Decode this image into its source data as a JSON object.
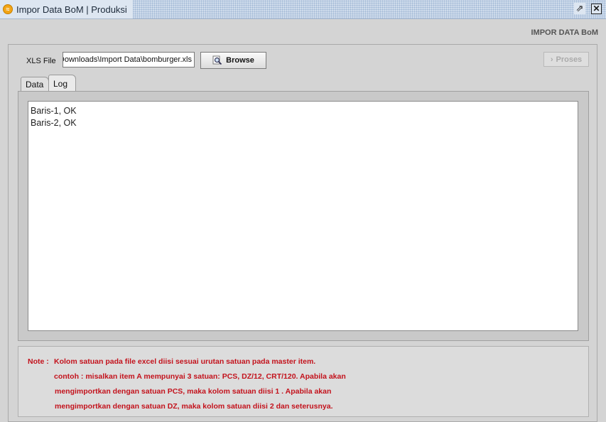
{
  "window": {
    "title": "Impor Data BoM | Produksi",
    "restore_icon": "restore-icon",
    "close_icon": "close-icon"
  },
  "header": {
    "label": "IMPOR DATA BoM"
  },
  "file": {
    "label": "XLS File",
    "value": "C:\\Users\\Downloads\\Import Data\\bomburger.xls"
  },
  "toolbar": {
    "browse_label": "Browse",
    "proses_label": "Proses"
  },
  "tabs": [
    {
      "label": "Data",
      "active": false
    },
    {
      "label": "Log",
      "active": true
    }
  ],
  "log": {
    "lines": [
      "Baris-1, OK",
      "Baris-2, OK"
    ]
  },
  "note": {
    "prefix": "Note :",
    "lines": [
      "Kolom satuan pada file excel diisi sesuai urutan satuan pada master item.",
      "contoh : misalkan item A mempunyai 3 satuan: PCS, DZ/12, CRT/120. Apabila akan",
      "mengimportkan dengan satuan PCS,  maka kolom satuan diisi 1 . Apabila akan",
      "mengimportkan dengan satuan DZ,  maka kolom satuan diisi 2 dan seterusnya."
    ]
  },
  "colors": {
    "note_text": "#c3121c",
    "title_bar": "#cfdcec"
  }
}
